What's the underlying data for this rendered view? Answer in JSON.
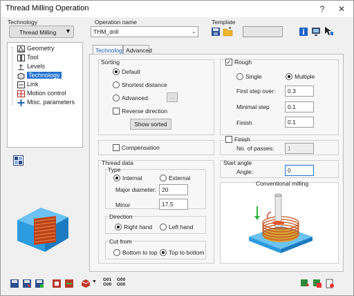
{
  "window": {
    "title": "Thread Milling Operation",
    "controls": [
      "?",
      "✕"
    ]
  },
  "technology": {
    "label": "Technology",
    "value": "Thread Milling"
  },
  "operation_name": {
    "label": "Operation name",
    "value": "THM_drill"
  },
  "template": {
    "label": "Template"
  },
  "tree": {
    "items": [
      "Geometry",
      "Tool",
      "Levels",
      "Technology",
      "Link",
      "Motion control",
      "Misc. parameters"
    ],
    "selected": "Technology"
  },
  "tabs": [
    "Technology",
    "Advanced"
  ],
  "sorting": {
    "label": "Sorting",
    "options": [
      "Default",
      "Shortest distance",
      "Advanced"
    ],
    "selected": "Default",
    "advanced_button": "...",
    "reverse_direction": "Reverse direction",
    "show_sorted": "Show sorted"
  },
  "rough": {
    "label": "Rough",
    "checked": true,
    "single": "Single",
    "multiple": "Multiple",
    "selected": "Multiple",
    "first_step_over_label": "First step over:",
    "first_step_over": "0.3",
    "minimal_step_label": "Minimal step",
    "minimal_step": "0.1",
    "finish_label": "Finish",
    "finish": "0.1"
  },
  "finish": {
    "label": "Finish",
    "checked": false,
    "passes_label": "No. of passes:",
    "passes": "1"
  },
  "compensation": {
    "label": "Compensation",
    "checked": false
  },
  "thread_data": {
    "label": "Thread data",
    "type_label": "Type",
    "internal": "Internal",
    "external": "External",
    "type_selected": "Internal",
    "major_diameter_label": "Major diameter:",
    "major_diameter": "20",
    "minor_label": "Minor",
    "minor": "17.5",
    "direction_label": "Direction",
    "right_hand": "Right hand",
    "left_hand": "Left hand",
    "direction_selected": "Right hand",
    "cut_from_label": "Cut from",
    "bottom_to_top": "Bottom to top",
    "top_to_bottom": "Top to bottom",
    "cut_from_selected": "Top to bottom"
  },
  "start_angle": {
    "label": "Start angle",
    "angle_label": "Angle:",
    "angle": "0"
  },
  "conventional": {
    "label": "Conventional milling"
  },
  "bottom_toolbar": {
    "g_code_1": [
      "G01",
      "G00"
    ],
    "g_code_2": [
      "G00",
      "G00"
    ]
  },
  "colors": {
    "accent": "#1e6fd0",
    "part_blue": "#3aa5e6",
    "thread_orange": "#e05a1e"
  }
}
